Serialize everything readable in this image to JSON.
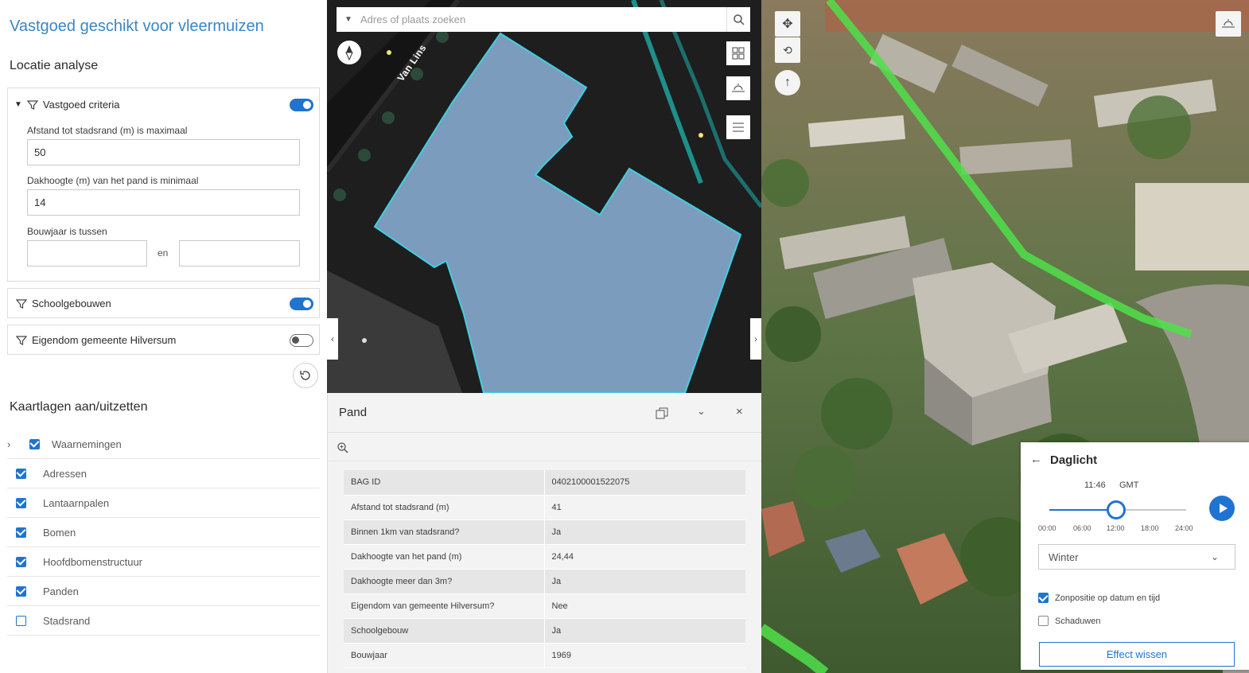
{
  "app": {
    "title": "Vastgoed geschikt voor vleermuizen"
  },
  "left_panel": {
    "section_location": "Locatie analyse",
    "criteria": {
      "label": "Vastgoed criteria",
      "enabled": true,
      "max_distance_label": "Afstand tot stadsrand (m) is maximaal",
      "max_distance_value": "50",
      "min_height_label": "Dakhoogte (m) van het pand is minimaal",
      "min_height_value": "14",
      "year_label": "Bouwjaar is tussen",
      "year_from": "",
      "year_sep": "en",
      "year_to": ""
    },
    "school_filter": {
      "label": "Schoolgebouwen",
      "enabled": true
    },
    "municipal_filter": {
      "label": "Eigendom gemeente Hilversum",
      "enabled": false
    },
    "section_layers": "Kaartlagen aan/uitzetten",
    "layers": [
      {
        "label": "Waarnemingen",
        "checked": true,
        "expandable": true
      },
      {
        "label": "Adressen",
        "checked": true
      },
      {
        "label": "Lantaarnpalen",
        "checked": true
      },
      {
        "label": "Bomen",
        "checked": true
      },
      {
        "label": "Hoofdbomenstructuur",
        "checked": true
      },
      {
        "label": "Panden",
        "checked": true
      },
      {
        "label": "Stadsrand",
        "checked": false
      }
    ]
  },
  "map": {
    "search_placeholder": "Adres of plaats zoeken",
    "street_label": "Van Lins"
  },
  "popup": {
    "title": "Pand",
    "rows": [
      {
        "key": "BAG ID",
        "value": "0402100001522075"
      },
      {
        "key": "Afstand tot stadsrand (m)",
        "value": "41"
      },
      {
        "key": "Binnen 1km van stadsrand?",
        "value": "Ja"
      },
      {
        "key": "Dakhoogte van het pand (m)",
        "value": "24,44"
      },
      {
        "key": "Dakhoogte meer dan 3m?",
        "value": "Ja"
      },
      {
        "key": "Eigendom van gemeente Hilversum?",
        "value": "Nee"
      },
      {
        "key": "Schoolgebouw",
        "value": "Ja"
      },
      {
        "key": "Bouwjaar",
        "value": "1969"
      }
    ]
  },
  "daylight": {
    "title": "Daglicht",
    "time": "11:46",
    "timezone": "GMT",
    "time_fraction": 0.49,
    "ticks": [
      "00:00",
      "06:00",
      "12:00",
      "18:00",
      "24:00"
    ],
    "season": "Winter",
    "sun_position_label": "Zonpositie op datum en tijd",
    "sun_position_checked": true,
    "shadows_label": "Schaduwen",
    "shadows_checked": false,
    "clear_button": "Effect wissen"
  },
  "colors": {
    "accent": "#1f73d1",
    "title_blue": "#3b86c4",
    "building_fill": "#7b9cbd",
    "building_outline": "#3fd0e0",
    "highlight_green": "#4fe04a"
  }
}
